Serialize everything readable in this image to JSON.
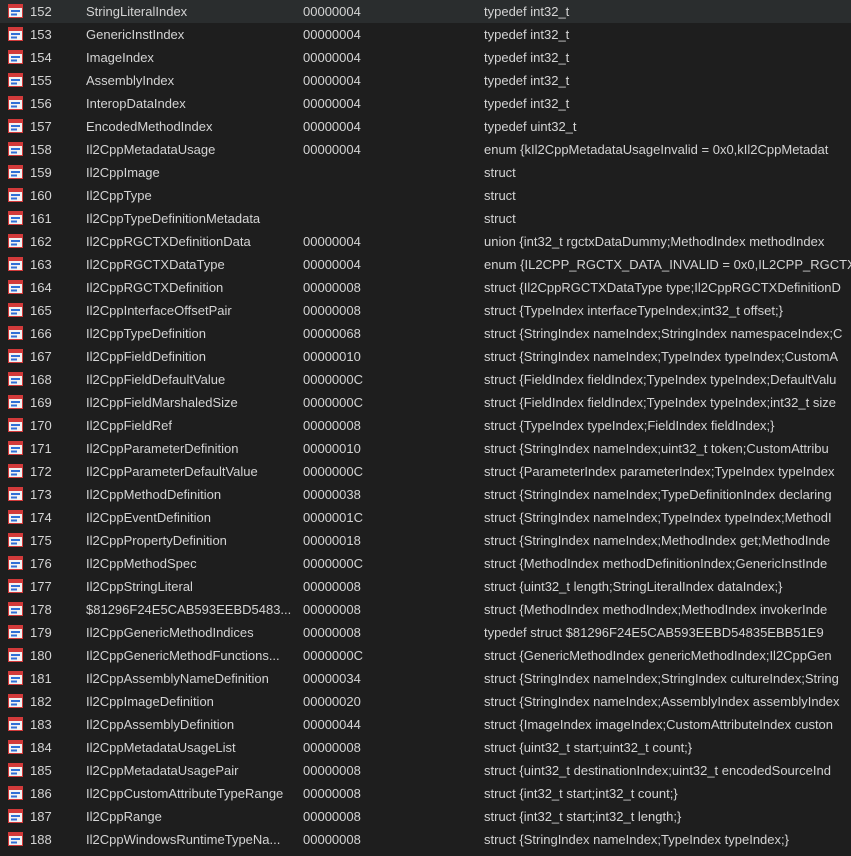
{
  "rows": [
    {
      "num": "152",
      "name": "StringLiteralIndex",
      "size": "00000004",
      "type": "typedef int32_t"
    },
    {
      "num": "153",
      "name": "GenericInstIndex",
      "size": "00000004",
      "type": "typedef int32_t"
    },
    {
      "num": "154",
      "name": "ImageIndex",
      "size": "00000004",
      "type": "typedef int32_t"
    },
    {
      "num": "155",
      "name": "AssemblyIndex",
      "size": "00000004",
      "type": "typedef int32_t"
    },
    {
      "num": "156",
      "name": "InteropDataIndex",
      "size": "00000004",
      "type": "typedef int32_t"
    },
    {
      "num": "157",
      "name": "EncodedMethodIndex",
      "size": "00000004",
      "type": "typedef uint32_t"
    },
    {
      "num": "158",
      "name": "Il2CppMetadataUsage",
      "size": "00000004",
      "type": "enum {kIl2CppMetadataUsageInvalid = 0x0,kIl2CppMetadat"
    },
    {
      "num": "159",
      "name": "Il2CppImage",
      "size": "",
      "type": "struct"
    },
    {
      "num": "160",
      "name": "Il2CppType",
      "size": "",
      "type": "struct"
    },
    {
      "num": "161",
      "name": "Il2CppTypeDefinitionMetadata",
      "size": "",
      "type": "struct"
    },
    {
      "num": "162",
      "name": "Il2CppRGCTXDefinitionData",
      "size": "00000004",
      "type": "union {int32_t rgctxDataDummy;MethodIndex methodIndex"
    },
    {
      "num": "163",
      "name": "Il2CppRGCTXDataType",
      "size": "00000004",
      "type": "enum {IL2CPP_RGCTX_DATA_INVALID = 0x0,IL2CPP_RGCTX"
    },
    {
      "num": "164",
      "name": "Il2CppRGCTXDefinition",
      "size": "00000008",
      "type": "struct {Il2CppRGCTXDataType type;Il2CppRGCTXDefinitionD"
    },
    {
      "num": "165",
      "name": "Il2CppInterfaceOffsetPair",
      "size": "00000008",
      "type": "struct {TypeIndex interfaceTypeIndex;int32_t offset;}"
    },
    {
      "num": "166",
      "name": "Il2CppTypeDefinition",
      "size": "00000068",
      "type": "struct {StringIndex nameIndex;StringIndex namespaceIndex;C"
    },
    {
      "num": "167",
      "name": "Il2CppFieldDefinition",
      "size": "00000010",
      "type": "struct {StringIndex nameIndex;TypeIndex typeIndex;CustomA"
    },
    {
      "num": "168",
      "name": "Il2CppFieldDefaultValue",
      "size": "0000000C",
      "type": "struct {FieldIndex fieldIndex;TypeIndex typeIndex;DefaultValu"
    },
    {
      "num": "169",
      "name": "Il2CppFieldMarshaledSize",
      "size": "0000000C",
      "type": "struct {FieldIndex fieldIndex;TypeIndex typeIndex;int32_t size"
    },
    {
      "num": "170",
      "name": "Il2CppFieldRef",
      "size": "00000008",
      "type": "struct {TypeIndex typeIndex;FieldIndex fieldIndex;}"
    },
    {
      "num": "171",
      "name": "Il2CppParameterDefinition",
      "size": "00000010",
      "type": "struct {StringIndex nameIndex;uint32_t token;CustomAttribu"
    },
    {
      "num": "172",
      "name": "Il2CppParameterDefaultValue",
      "size": "0000000C",
      "type": "struct {ParameterIndex parameterIndex;TypeIndex typeIndex"
    },
    {
      "num": "173",
      "name": "Il2CppMethodDefinition",
      "size": "00000038",
      "type": "struct {StringIndex nameIndex;TypeDefinitionIndex declaring"
    },
    {
      "num": "174",
      "name": "Il2CppEventDefinition",
      "size": "0000001C",
      "type": "struct {StringIndex nameIndex;TypeIndex typeIndex;MethodI"
    },
    {
      "num": "175",
      "name": "Il2CppPropertyDefinition",
      "size": "00000018",
      "type": "struct {StringIndex nameIndex;MethodIndex get;MethodInde"
    },
    {
      "num": "176",
      "name": "Il2CppMethodSpec",
      "size": "0000000C",
      "type": "struct {MethodIndex methodDefinitionIndex;GenericInstInde"
    },
    {
      "num": "177",
      "name": "Il2CppStringLiteral",
      "size": "00000008",
      "type": "struct {uint32_t length;StringLiteralIndex dataIndex;}"
    },
    {
      "num": "178",
      "name": "$81296F24E5CAB593EEBD5483...",
      "size": "00000008",
      "type": "struct {MethodIndex methodIndex;MethodIndex invokerInde"
    },
    {
      "num": "179",
      "name": "Il2CppGenericMethodIndices",
      "size": "00000008",
      "type": "typedef struct $81296F24E5CAB593EEBD54835EBB51E9"
    },
    {
      "num": "180",
      "name": "Il2CppGenericMethodFunctions...",
      "size": "0000000C",
      "type": "struct {GenericMethodIndex genericMethodIndex;Il2CppGen"
    },
    {
      "num": "181",
      "name": "Il2CppAssemblyNameDefinition",
      "size": "00000034",
      "type": "struct {StringIndex nameIndex;StringIndex cultureIndex;String"
    },
    {
      "num": "182",
      "name": "Il2CppImageDefinition",
      "size": "00000020",
      "type": "struct {StringIndex nameIndex;AssemblyIndex assemblyIndex"
    },
    {
      "num": "183",
      "name": "Il2CppAssemblyDefinition",
      "size": "00000044",
      "type": "struct {ImageIndex imageIndex;CustomAttributeIndex custon"
    },
    {
      "num": "184",
      "name": "Il2CppMetadataUsageList",
      "size": "00000008",
      "type": "struct {uint32_t start;uint32_t count;}"
    },
    {
      "num": "185",
      "name": "Il2CppMetadataUsagePair",
      "size": "00000008",
      "type": "struct {uint32_t destinationIndex;uint32_t encodedSourceInd"
    },
    {
      "num": "186",
      "name": "Il2CppCustomAttributeTypeRange",
      "size": "00000008",
      "type": "struct {int32_t start;int32_t count;}"
    },
    {
      "num": "187",
      "name": "Il2CppRange",
      "size": "00000008",
      "type": "struct {int32_t start;int32_t length;}"
    },
    {
      "num": "188",
      "name": "Il2CppWindowsRuntimeTypeNa...",
      "size": "00000008",
      "type": "struct {StringIndex nameIndex;TypeIndex typeIndex;}"
    }
  ],
  "row_icon": "structure-icon",
  "colors": {
    "background": "#1e1e1e",
    "text": "#d4d4d4",
    "icon_red": "#d23a3a",
    "icon_blue": "#2f6fd6"
  }
}
